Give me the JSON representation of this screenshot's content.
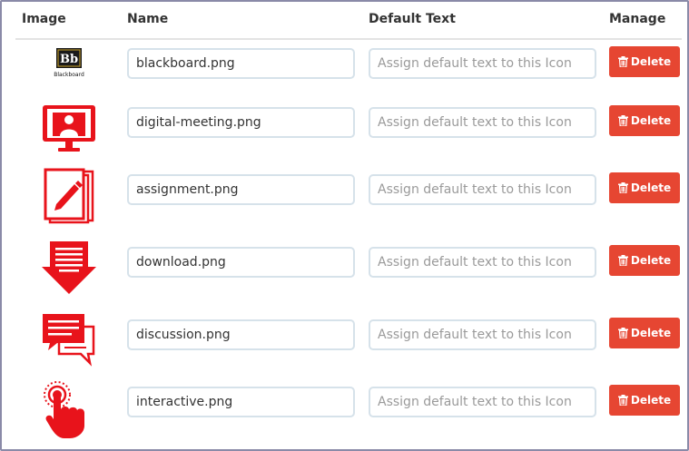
{
  "headers": {
    "image": "Image",
    "name": "Name",
    "default_text": "Default Text",
    "manage": "Manage"
  },
  "rows": [
    {
      "icon": "blackboard-logo-icon",
      "name": "blackboard.png",
      "default_placeholder": "Assign default text to this Icon",
      "delete_label": "Delete",
      "logo_text": "Bb",
      "logo_caption": "Blackboard"
    },
    {
      "icon": "digital-meeting-icon",
      "name": "digital-meeting.png",
      "default_placeholder": "Assign default text to this Icon",
      "delete_label": "Delete"
    },
    {
      "icon": "assignment-icon",
      "name": "assignment.png",
      "default_placeholder": "Assign default text to this Icon",
      "delete_label": "Delete"
    },
    {
      "icon": "download-icon",
      "name": "download.png",
      "default_placeholder": "Assign default text to this Icon",
      "delete_label": "Delete"
    },
    {
      "icon": "discussion-icon",
      "name": "discussion.png",
      "default_placeholder": "Assign default text to this Icon",
      "delete_label": "Delete"
    },
    {
      "icon": "interactive-icon",
      "name": "interactive.png",
      "default_placeholder": "Assign default text to this Icon",
      "delete_label": "Delete"
    }
  ],
  "colors": {
    "icon_red": "#e8131b",
    "delete_button": "#e64632",
    "input_border": "#d6e2ea"
  }
}
